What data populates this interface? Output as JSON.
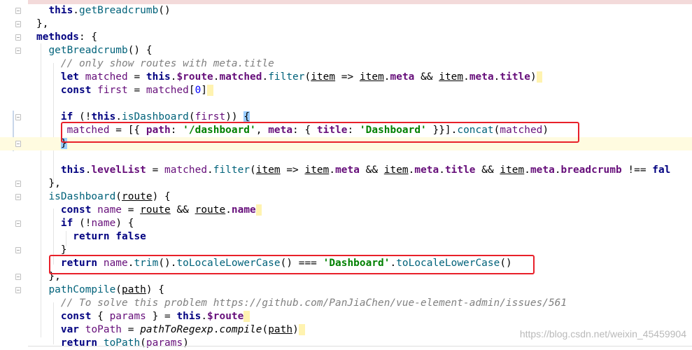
{
  "lines": [
    {
      "id": "l1",
      "tokens": [
        {
          "t": "  "
        },
        {
          "t": "this",
          "c": "kw"
        },
        {
          "t": "."
        },
        {
          "t": "getBreadcrumb",
          "c": "fn"
        },
        {
          "t": "()"
        }
      ]
    },
    {
      "id": "l2",
      "tokens": [
        {
          "t": "},"
        }
      ]
    },
    {
      "id": "l3",
      "tokens": [
        {
          "t": "methods",
          "c": "kw"
        },
        {
          "t": ": {"
        }
      ]
    },
    {
      "id": "l4",
      "tokens": [
        {
          "t": "  "
        },
        {
          "t": "getBreadcrumb",
          "c": "fn"
        },
        {
          "t": "() {"
        }
      ]
    },
    {
      "id": "l5",
      "tokens": [
        {
          "t": "    "
        },
        {
          "t": "// only show routes with meta.title",
          "c": "cmt"
        }
      ]
    },
    {
      "id": "l6",
      "tokens": [
        {
          "t": "    "
        },
        {
          "t": "let",
          "c": "kw"
        },
        {
          "t": " "
        },
        {
          "t": "matched",
          "c": "prop"
        },
        {
          "t": " = "
        },
        {
          "t": "this",
          "c": "kw"
        },
        {
          "t": "."
        },
        {
          "t": "$route",
          "c": "propb"
        },
        {
          "t": "."
        },
        {
          "t": "matched",
          "c": "propb"
        },
        {
          "t": "."
        },
        {
          "t": "filter",
          "c": "fn"
        },
        {
          "t": "("
        },
        {
          "t": "item",
          "c": "und"
        },
        {
          "t": " => "
        },
        {
          "t": "item",
          "c": "und"
        },
        {
          "t": "."
        },
        {
          "t": "meta",
          "c": "propb"
        },
        {
          "t": " && "
        },
        {
          "t": "item",
          "c": "und"
        },
        {
          "t": "."
        },
        {
          "t": "meta",
          "c": "propb"
        },
        {
          "t": "."
        },
        {
          "t": "title",
          "c": "propb"
        },
        {
          "t": ")"
        },
        {
          "t": " ",
          "c": "pair-hl"
        }
      ]
    },
    {
      "id": "l7",
      "tokens": [
        {
          "t": "    "
        },
        {
          "t": "const",
          "c": "kw"
        },
        {
          "t": " "
        },
        {
          "t": "first",
          "c": "prop"
        },
        {
          "t": " = "
        },
        {
          "t": "matched",
          "c": "prop"
        },
        {
          "t": "["
        },
        {
          "t": "0",
          "c": "num"
        },
        {
          "t": "]"
        },
        {
          "t": " ",
          "c": "pair-hl"
        }
      ]
    },
    {
      "id": "l8",
      "tokens": [
        {
          "t": ""
        }
      ]
    },
    {
      "id": "l9",
      "tokens": [
        {
          "t": "    "
        },
        {
          "t": "if",
          "c": "kw"
        },
        {
          "t": " (!"
        },
        {
          "t": "this",
          "c": "kw"
        },
        {
          "t": "."
        },
        {
          "t": "isDashboard",
          "c": "fn"
        },
        {
          "t": "("
        },
        {
          "t": "first",
          "c": "prop"
        },
        {
          "t": ")) "
        },
        {
          "t": "{",
          "c": "brace-hl"
        }
      ]
    },
    {
      "id": "l10",
      "tokens": [
        {
          "t": "     "
        },
        {
          "t": "matched",
          "c": "prop"
        },
        {
          "t": " = [{ "
        },
        {
          "t": "path",
          "c": "propb"
        },
        {
          "t": ": "
        },
        {
          "t": "'/dashboard'",
          "c": "str"
        },
        {
          "t": ", "
        },
        {
          "t": "meta",
          "c": "propb"
        },
        {
          "t": ": { "
        },
        {
          "t": "title",
          "c": "propb"
        },
        {
          "t": ": "
        },
        {
          "t": "'Dashboard'",
          "c": "str"
        },
        {
          "t": " }}]."
        },
        {
          "t": "concat",
          "c": "fn"
        },
        {
          "t": "("
        },
        {
          "t": "matched",
          "c": "prop"
        },
        {
          "t": ")"
        }
      ]
    },
    {
      "id": "l11",
      "tokens": [
        {
          "t": "    "
        },
        {
          "t": "}",
          "c": "brace-hl"
        }
      ]
    },
    {
      "id": "l12",
      "tokens": [
        {
          "t": ""
        }
      ]
    },
    {
      "id": "l13",
      "tokens": [
        {
          "t": "    "
        },
        {
          "t": "this",
          "c": "kw"
        },
        {
          "t": "."
        },
        {
          "t": "levelList",
          "c": "propb"
        },
        {
          "t": " = "
        },
        {
          "t": "matched",
          "c": "prop"
        },
        {
          "t": "."
        },
        {
          "t": "filter",
          "c": "fn"
        },
        {
          "t": "("
        },
        {
          "t": "item",
          "c": "und"
        },
        {
          "t": " => "
        },
        {
          "t": "item",
          "c": "und"
        },
        {
          "t": "."
        },
        {
          "t": "meta",
          "c": "propb"
        },
        {
          "t": " && "
        },
        {
          "t": "item",
          "c": "und"
        },
        {
          "t": "."
        },
        {
          "t": "meta",
          "c": "propb"
        },
        {
          "t": "."
        },
        {
          "t": "title",
          "c": "propb"
        },
        {
          "t": " && "
        },
        {
          "t": "item",
          "c": "und"
        },
        {
          "t": "."
        },
        {
          "t": "meta",
          "c": "propb"
        },
        {
          "t": "."
        },
        {
          "t": "breadcrumb",
          "c": "propb"
        },
        {
          "t": " !== "
        },
        {
          "t": "fal",
          "c": "kw"
        }
      ]
    },
    {
      "id": "l14",
      "tokens": [
        {
          "t": "  },"
        }
      ]
    },
    {
      "id": "l15",
      "tokens": [
        {
          "t": "  "
        },
        {
          "t": "isDashboard",
          "c": "fn"
        },
        {
          "t": "("
        },
        {
          "t": "route",
          "c": "und"
        },
        {
          "t": ") {"
        }
      ]
    },
    {
      "id": "l16",
      "tokens": [
        {
          "t": "    "
        },
        {
          "t": "const",
          "c": "kw"
        },
        {
          "t": " "
        },
        {
          "t": "name",
          "c": "prop"
        },
        {
          "t": " = "
        },
        {
          "t": "route",
          "c": "und"
        },
        {
          "t": " && "
        },
        {
          "t": "route",
          "c": "und"
        },
        {
          "t": "."
        },
        {
          "t": "name",
          "c": "propb"
        },
        {
          "t": " ",
          "c": "pair-hl"
        }
      ]
    },
    {
      "id": "l17",
      "tokens": [
        {
          "t": "    "
        },
        {
          "t": "if",
          "c": "kw"
        },
        {
          "t": " (!"
        },
        {
          "t": "name",
          "c": "prop"
        },
        {
          "t": ") {"
        }
      ]
    },
    {
      "id": "l18",
      "tokens": [
        {
          "t": "      "
        },
        {
          "t": "return",
          "c": "kw"
        },
        {
          "t": " "
        },
        {
          "t": "false",
          "c": "kw"
        }
      ]
    },
    {
      "id": "l19",
      "tokens": [
        {
          "t": "    }"
        }
      ]
    },
    {
      "id": "l20",
      "tokens": [
        {
          "t": "    "
        },
        {
          "t": "return",
          "c": "kw"
        },
        {
          "t": " "
        },
        {
          "t": "name",
          "c": "prop"
        },
        {
          "t": "."
        },
        {
          "t": "trim",
          "c": "fn"
        },
        {
          "t": "()."
        },
        {
          "t": "toLocaleLowerCase",
          "c": "fn"
        },
        {
          "t": "() === "
        },
        {
          "t": "'Dashboard'",
          "c": "str"
        },
        {
          "t": "."
        },
        {
          "t": "toLocaleLowerCase",
          "c": "fn"
        },
        {
          "t": "()"
        }
      ]
    },
    {
      "id": "l21",
      "tokens": [
        {
          "t": "  },"
        }
      ]
    },
    {
      "id": "l22",
      "tokens": [
        {
          "t": "  "
        },
        {
          "t": "pathCompile",
          "c": "fn"
        },
        {
          "t": "("
        },
        {
          "t": "path",
          "c": "und"
        },
        {
          "t": ") {"
        }
      ]
    },
    {
      "id": "l23",
      "tokens": [
        {
          "t": "    "
        },
        {
          "t": "// To solve this problem https://github.com/PanJiaChen/vue-element-admin/issues/561",
          "c": "cmt"
        }
      ]
    },
    {
      "id": "l24",
      "tokens": [
        {
          "t": "    "
        },
        {
          "t": "const",
          "c": "kw"
        },
        {
          "t": " { "
        },
        {
          "t": "params",
          "c": "prop"
        },
        {
          "t": " } = "
        },
        {
          "t": "this",
          "c": "kw"
        },
        {
          "t": "."
        },
        {
          "t": "$route",
          "c": "propb"
        },
        {
          "t": " ",
          "c": "pair-hl"
        }
      ]
    },
    {
      "id": "l25",
      "tokens": [
        {
          "t": "    "
        },
        {
          "t": "var",
          "c": "kw"
        },
        {
          "t": " "
        },
        {
          "t": "toPath",
          "c": "prop"
        },
        {
          "t": " = "
        },
        {
          "t": "pathToRegexp",
          "c": "ita"
        },
        {
          "t": "."
        },
        {
          "t": "compile",
          "c": "ita"
        },
        {
          "t": "("
        },
        {
          "t": "path",
          "c": "und"
        },
        {
          "t": ")"
        },
        {
          "t": " ",
          "c": "pair-hl"
        }
      ]
    },
    {
      "id": "l26",
      "tokens": [
        {
          "t": "    "
        },
        {
          "t": "return",
          "c": "kw"
        },
        {
          "t": " "
        },
        {
          "t": "toPath",
          "c": "fn"
        },
        {
          "t": "("
        },
        {
          "t": "params",
          "c": "prop"
        },
        {
          "t": ")"
        }
      ]
    }
  ],
  "watermark": "https://blog.csdn.net/weixin_45459904",
  "colors": {
    "highlight_box": "#e8202a",
    "keyword": "#000080",
    "string": "#008000",
    "comment": "#808080",
    "property": "#660e7a"
  }
}
